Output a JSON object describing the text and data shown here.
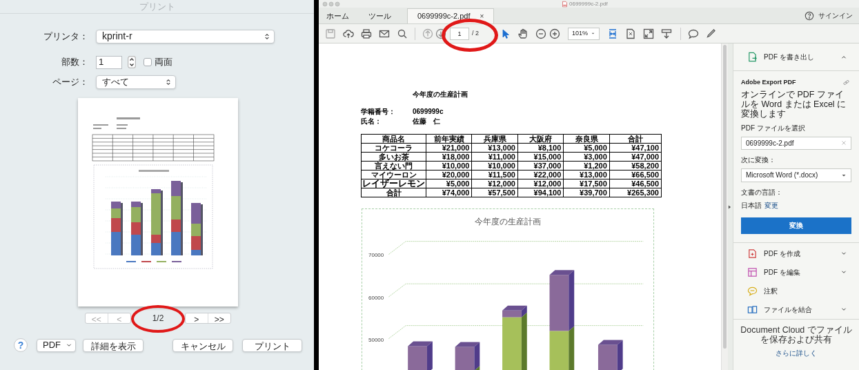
{
  "print_dialog": {
    "title": "プリント",
    "printer": {
      "label": "プリンタ：",
      "value": "kprint-r"
    },
    "copies": {
      "label": "部数：",
      "value": "1"
    },
    "duplex": {
      "label": "両面",
      "checked": false
    },
    "pages": {
      "label": "ページ：",
      "value": "すべて"
    },
    "page_nav": {
      "first": "<<",
      "prev": "<",
      "indicator": "1/2",
      "next": ">",
      "last": ">>"
    },
    "buttons": [
      {
        "kind": "help",
        "label": "?"
      },
      {
        "kind": "menu",
        "label": "PDF"
      },
      {
        "kind": "plain",
        "label": "詳細を表示"
      },
      {
        "kind": "plain",
        "label": "キャンセル"
      },
      {
        "kind": "plain",
        "label": "プリント"
      }
    ]
  },
  "acrobat": {
    "title": "0699999c-2.pdf",
    "tabs": [
      {
        "label": "ホーム",
        "selected": false,
        "closable": false
      },
      {
        "label": "ツール",
        "selected": false,
        "closable": false
      },
      {
        "label": "0699999c-2.pdf",
        "selected": true,
        "closable": true,
        "close": "×"
      }
    ],
    "sign_in": "サインイン",
    "toolbar": {
      "page": "1",
      "page_total": "/ 2",
      "zoom": "101%"
    },
    "document": {
      "title": "今年度の生産計画",
      "info": [
        {
          "label": "学籍番号：",
          "value": "0699999c"
        },
        {
          "label": "氏名：",
          "value": "佐藤　仁"
        }
      ],
      "table": {
        "columns": [
          "商品名",
          "前年実績",
          "兵庫県",
          "大阪府",
          "奈良県",
          "合計"
        ],
        "rows": [
          [
            "コケコーラ",
            "¥21,000",
            "¥13,000",
            "¥8,100",
            "¥5,000",
            "¥47,100"
          ],
          [
            "多いお茶",
            "¥18,000",
            "¥11,000",
            "¥15,000",
            "¥3,000",
            "¥47,000"
          ],
          [
            "言えない門",
            "¥10,000",
            "¥10,000",
            "¥37,000",
            "¥1,200",
            "¥58,200"
          ],
          [
            "マイウーロン",
            "¥20,000",
            "¥11,500",
            "¥22,000",
            "¥13,000",
            "¥66,500"
          ],
          [
            "レイザーレモン",
            "¥5,000",
            "¥12,000",
            "¥12,000",
            "¥17,500",
            "¥46,500"
          ],
          [
            "合計",
            "¥74,000",
            "¥57,500",
            "¥94,100",
            "¥39,700",
            "¥265,300"
          ]
        ]
      },
      "chart": {
        "title": "今年度の生産計画",
        "y_labels": [
          "70000",
          "60000",
          "50000"
        ]
      }
    },
    "sidebar": {
      "export": {
        "title": "PDF を書き出し",
        "expanded": true,
        "heading": "Adobe Export PDF",
        "description": "オンラインで PDF ファイルを Word または Excel に変換します",
        "file_label": "PDF ファイルを選択",
        "file_value": "0699999c-2.pdf",
        "convert_label": "次に変換：",
        "convert_value": "Microsoft Word (*.docx)",
        "language_label": "文書の言語：",
        "language_value": "日本語",
        "change_link": "変更",
        "button": "変換"
      },
      "tools": [
        {
          "kind": "create",
          "label": "PDF を作成",
          "expandable": true
        },
        {
          "kind": "edit",
          "label": "PDF を編集",
          "expandable": true
        },
        {
          "kind": "comment",
          "label": "注釈",
          "expandable": false
        },
        {
          "kind": "combine",
          "label": "ファイルを結合",
          "expandable": true
        }
      ],
      "cloud_text": "Document Cloud でファイルを保存および共有",
      "learn_more": "さらに詳しく"
    }
  }
}
